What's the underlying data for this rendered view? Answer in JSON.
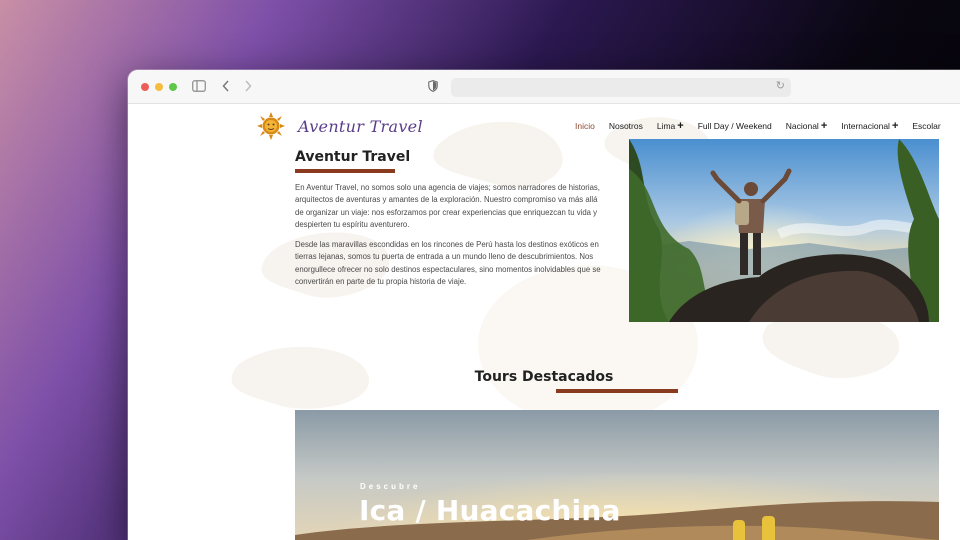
{
  "browser": {
    "url": "",
    "icons": [
      "sidebar-icon",
      "back-icon",
      "forward-icon",
      "shield-icon",
      "reload-icon"
    ]
  },
  "site": {
    "logo_text": "Aventur Travel",
    "nav": {
      "items": [
        {
          "label": "Inicio",
          "active": true,
          "has_plus": false
        },
        {
          "label": "Nosotros",
          "active": false,
          "has_plus": false
        },
        {
          "label": "Lima",
          "active": false,
          "has_plus": true
        },
        {
          "label": "Full Day / Weekend",
          "active": false,
          "has_plus": false
        },
        {
          "label": "Nacional",
          "active": false,
          "has_plus": true
        },
        {
          "label": "Internacional",
          "active": false,
          "has_plus": true
        },
        {
          "label": "Escolar",
          "active": false,
          "has_plus": false
        }
      ],
      "plus_glyph": "+"
    }
  },
  "about": {
    "title": "Aventur Travel",
    "paragraphs": [
      "En Aventur Travel, no somos solo una agencia de viajes; somos narradores de historias, arquitectos de aventuras y amantes de la exploración. Nuestro compromiso va más allá de organizar un viaje: nos esforzamos por crear experiencias que enriquezcan tu vida y despierten tu espíritu aventurero.",
      "Desde las maravillas escondidas en los rincones de Perú hasta los destinos exóticos en tierras lejanas, somos tu puerta de entrada a un mundo lleno de descubrimientos. Nos enorgullece ofrecer no solo destinos espectaculares, sino momentos inolvidables que se convertirán en parte de tu propia historia de viaje."
    ]
  },
  "tours": {
    "title": "Tours Destacados",
    "banner": {
      "kicker": "Descubre",
      "title": "Ica / Huacachina"
    }
  },
  "colors": {
    "accent": "#8a3a1e",
    "logo": "#5a3d88",
    "active_nav": "#8c4a2f"
  }
}
